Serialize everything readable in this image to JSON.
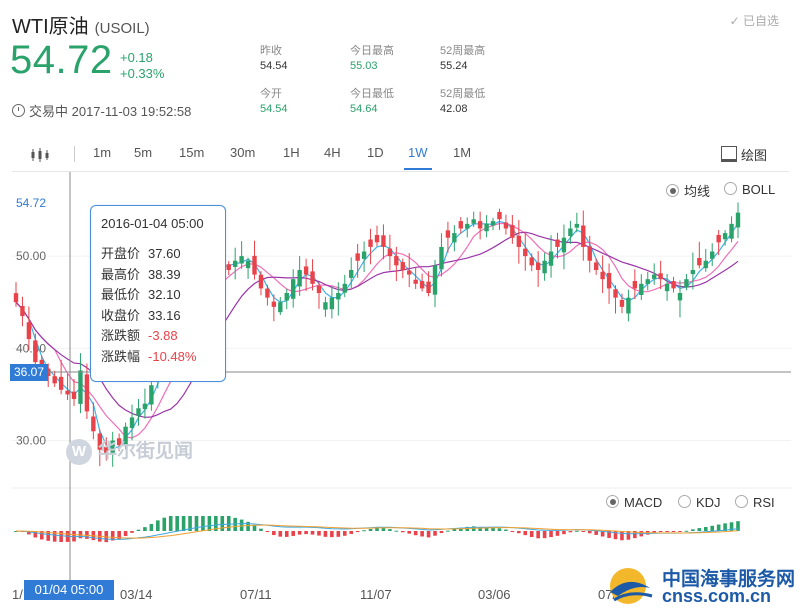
{
  "header": {
    "name": "WTI原油",
    "code": "(USOIL)",
    "watch_label": "已自选",
    "price": "54.72",
    "change": "+0.18",
    "change_pct": "+0.33%",
    "status": "交易中 2017-11-03 19:52:58",
    "up_color": "#2aa36b",
    "down_color": "#e8434a",
    "stats": [
      {
        "key": "昨收",
        "value": "54.54",
        "green": false
      },
      {
        "key": "今日最高",
        "value": "55.03",
        "green": true
      },
      {
        "key": "52周最高",
        "value": "55.24",
        "green": false
      },
      {
        "key": "今开",
        "value": "54.54",
        "green": true
      },
      {
        "key": "今日最低",
        "value": "54.64",
        "green": true
      },
      {
        "key": "52周最低",
        "value": "42.08",
        "green": false
      }
    ]
  },
  "toolbar": {
    "periods": [
      "1m",
      "5m",
      "15m",
      "30m",
      "1H",
      "4H",
      "1D",
      "1W",
      "1M"
    ],
    "active": "1W",
    "draw_label": "绘图",
    "accent": "#2f7bd6"
  },
  "overlay_options": [
    {
      "label": "均线",
      "selected": true
    },
    {
      "label": "BOLL",
      "selected": false
    }
  ],
  "indicator_options": [
    {
      "label": "MACD",
      "selected": true
    },
    {
      "label": "KDJ",
      "selected": false
    },
    {
      "label": "RSI",
      "selected": false
    }
  ],
  "tooltip": {
    "time": "2016-01-04 05:00",
    "rows": [
      {
        "key": "开盘价",
        "value": "37.60",
        "red": false
      },
      {
        "key": "最高价",
        "value": "38.39",
        "red": false
      },
      {
        "key": "最低价",
        "value": "32.10",
        "red": false
      },
      {
        "key": "收盘价",
        "value": "33.16",
        "red": false
      },
      {
        "key": "涨跌额",
        "value": "-3.88",
        "red": true
      },
      {
        "key": "涨跌幅",
        "value": "-10.48%",
        "red": true
      }
    ]
  },
  "crosshair": {
    "x_label": "01/04 05:00",
    "y_label": "36.07"
  },
  "watermark": "华尔街见闻",
  "brand": {
    "name": "中国海事服务网",
    "domain": "cnss.com.cn"
  },
  "chart_data": {
    "type": "candlestick",
    "title": "WTI原油 (USOIL) 1W",
    "y_ticks": [
      30.0,
      40.0,
      50.0
    ],
    "y_tick_labels": [
      "30.00",
      "40.00",
      "50.00"
    ],
    "current_price_label": "54.72",
    "ylim": [
      25.5,
      57.5
    ],
    "x_tick_labels": [
      "1/",
      "03/14",
      "07/11",
      "11/07",
      "03/06",
      "07/0"
    ],
    "moving_averages": [
      {
        "name": "MA-short",
        "color": "#3fb0e6"
      },
      {
        "name": "MA-mid",
        "color": "#f06fb8"
      },
      {
        "name": "MA-long",
        "color": "#9b36a8"
      }
    ],
    "ohlc_close": [
      45.0,
      43.5,
      41.0,
      38.5,
      37.8,
      37.0,
      36.2,
      35.5,
      35.0,
      34.5,
      37.6,
      33.16,
      31.0,
      29.0,
      28.5,
      30.0,
      29.5,
      31.5,
      32.5,
      33.5,
      34.0,
      36.0,
      38.5,
      39.5,
      41.0,
      42.0,
      44.0,
      45.5,
      46.5,
      47.5,
      48.0,
      49.0,
      49.5,
      48.5,
      49.5,
      50.0,
      49.5,
      48.0,
      46.5,
      45.5,
      44.5,
      45.0,
      46.0,
      47.5,
      48.5,
      48.0,
      47.0,
      46.0,
      45.0,
      45.5,
      46.0,
      47.0,
      48.5,
      49.5,
      50.5,
      51.0,
      51.5,
      51.0,
      50.0,
      49.0,
      48.5,
      48.0,
      47.0,
      46.5,
      46.0,
      49.0,
      51.0,
      52.0,
      52.5,
      53.0,
      53.5,
      54.0,
      53.0,
      53.5,
      53.8,
      54.0,
      53.0,
      52.0,
      51.0,
      50.0,
      49.0,
      48.5,
      49.5,
      50.5,
      51.0,
      52.0,
      53.0,
      53.5,
      51.0,
      49.5,
      48.5,
      47.5,
      46.5,
      45.5,
      44.5,
      45.5,
      46.5,
      47.0,
      47.5,
      48.0,
      47.5,
      47.0,
      46.5,
      46.0,
      47.5,
      48.5,
      49.0,
      49.5,
      50.5,
      51.5,
      52.5,
      53.5,
      54.72
    ],
    "indicator": "MACD"
  }
}
